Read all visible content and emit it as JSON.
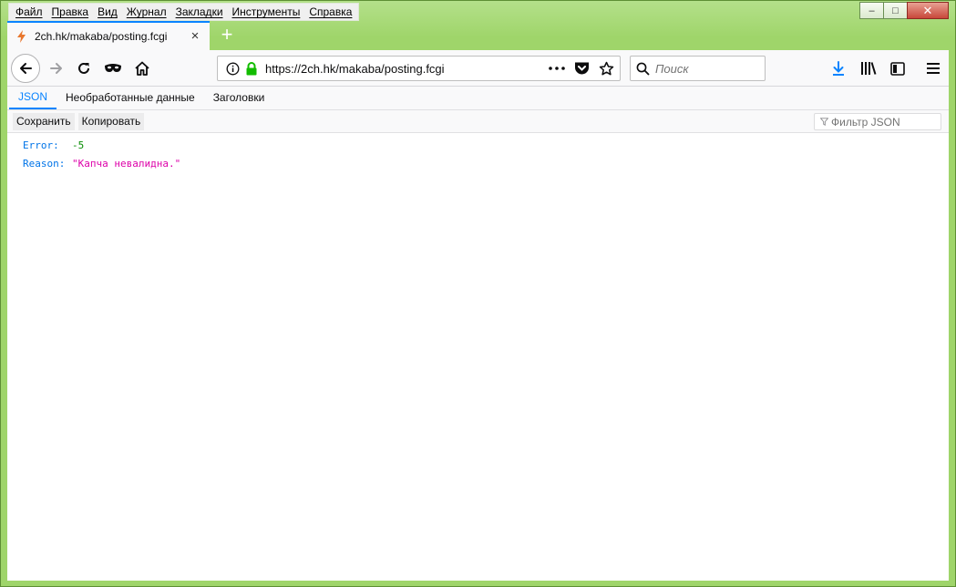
{
  "menubar": {
    "items": [
      "Файл",
      "Правка",
      "Вид",
      "Журнал",
      "Закладки",
      "Инструменты",
      "Справка"
    ]
  },
  "window_controls": {
    "minimize": "–",
    "maximize": "□",
    "close": "✕"
  },
  "tab": {
    "title": "2ch.hk/makaba/posting.fcgi",
    "close": "×"
  },
  "new_tab": "+",
  "urlbar": {
    "url": "https://2ch.hk/makaba/posting.fcgi"
  },
  "search": {
    "placeholder": "Поиск"
  },
  "viewer": {
    "tabs": [
      "JSON",
      "Необработанные данные",
      "Заголовки"
    ],
    "active_tab": "JSON",
    "toolbar": {
      "save": "Сохранить",
      "copy": "Копировать"
    },
    "filter": {
      "placeholder": "Фильтр JSON"
    },
    "rows": [
      {
        "key": "Error:",
        "value": "-5",
        "type": "number"
      },
      {
        "key": "Reason:",
        "value": "\"Капча невалидна.\"",
        "type": "string"
      }
    ]
  },
  "colors": {
    "accent": "#0a84ff",
    "json_key": "#0074e8",
    "json_number": "#058b00",
    "json_string": "#dd00a9",
    "secure_lock": "#12bc00",
    "download_icon": "#0a84ff"
  }
}
